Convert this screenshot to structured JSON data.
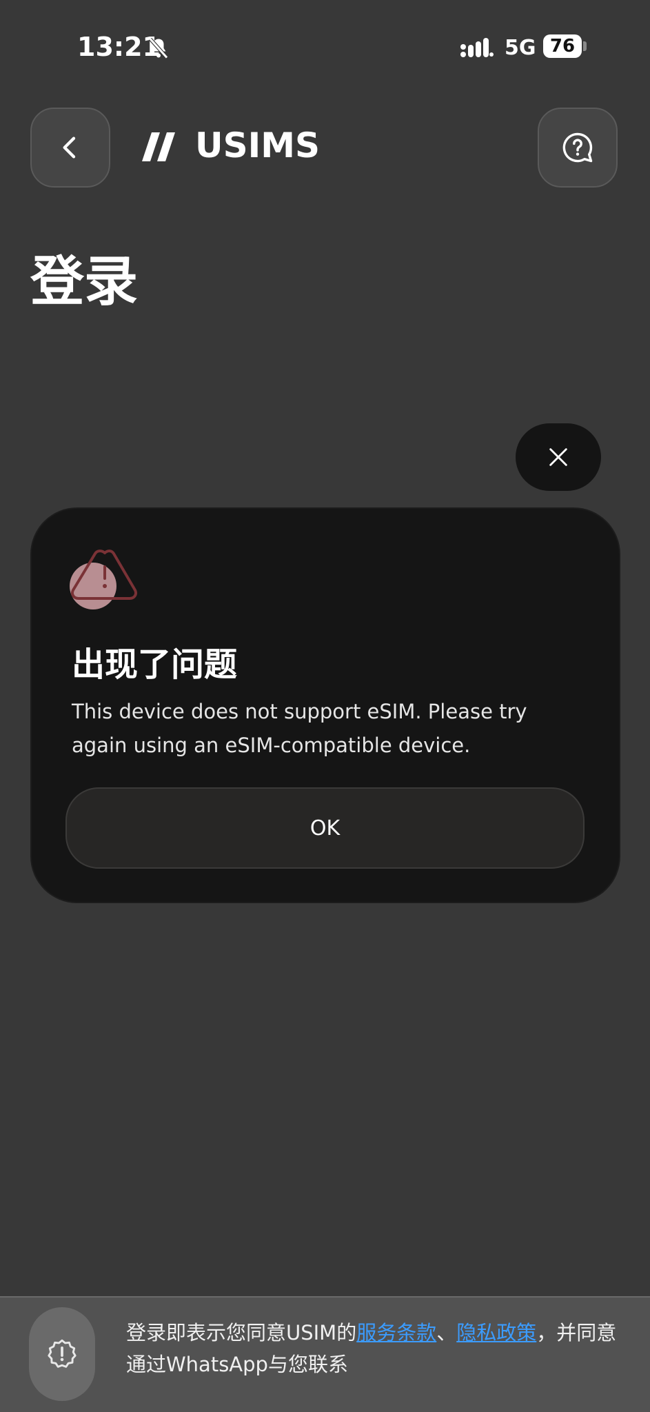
{
  "status_bar": {
    "time": "13:21",
    "network": "5G",
    "battery": "76",
    "icons": [
      "bell-slash-icon",
      "signal-icon"
    ]
  },
  "header": {
    "brand": "USIMS",
    "icons": [
      "back-chevron-icon",
      "brand-logo-icon",
      "help-question-icon"
    ]
  },
  "page": {
    "title": "登录"
  },
  "dialog": {
    "title": "出现了问题",
    "message": "This device does not support eSIM. Please try again using an eSIM-compatible device.",
    "ok_label": "OK",
    "icons": [
      "warning-icon",
      "close-icon"
    ]
  },
  "consent": {
    "prefix": "登录即表示您同意USIM的",
    "terms_link": "服务条款",
    "separator": "、",
    "privacy_link": "隐私政策",
    "suffix": "，并同意通过WhatsApp与您联系",
    "icon": "shield-alert-icon"
  },
  "colors": {
    "background": "#383838",
    "dialog": "#151515",
    "link": "#3b9cff",
    "warning": "#b88e92"
  }
}
